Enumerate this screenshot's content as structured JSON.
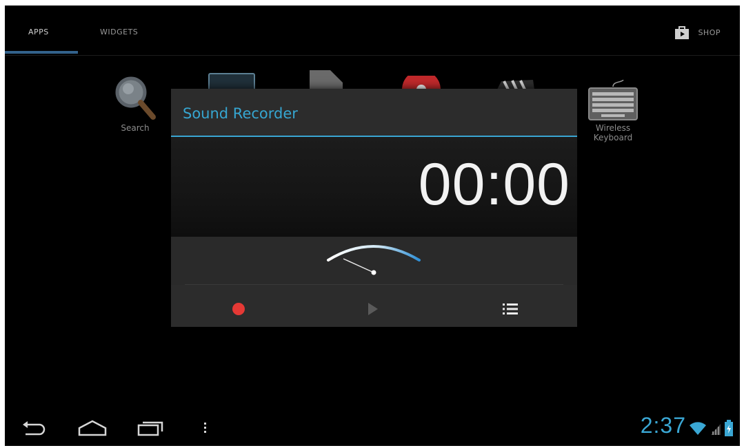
{
  "launcher": {
    "tabs": [
      {
        "label": "APPS"
      },
      {
        "label": "WIDGETS"
      }
    ],
    "shop_label": "SHOP",
    "apps": [
      {
        "label": "Search",
        "icon": "magnifier-icon"
      },
      {
        "label": "Wireless Keyboard",
        "icon": "keyboard-icon"
      }
    ]
  },
  "dialog": {
    "title": "Sound Recorder",
    "timer": "00:00",
    "controls": [
      {
        "name": "record",
        "icon": "record-icon"
      },
      {
        "name": "play",
        "icon": "play-icon"
      },
      {
        "name": "list",
        "icon": "list-icon"
      }
    ]
  },
  "status_bar": {
    "time": "2:37",
    "icons": [
      "wifi-icon",
      "signal-icon",
      "battery-icon"
    ]
  },
  "colors": {
    "accent": "#3aa7d4",
    "record": "#e53935",
    "background": "#000000",
    "dialog": "#2c2c2c"
  }
}
